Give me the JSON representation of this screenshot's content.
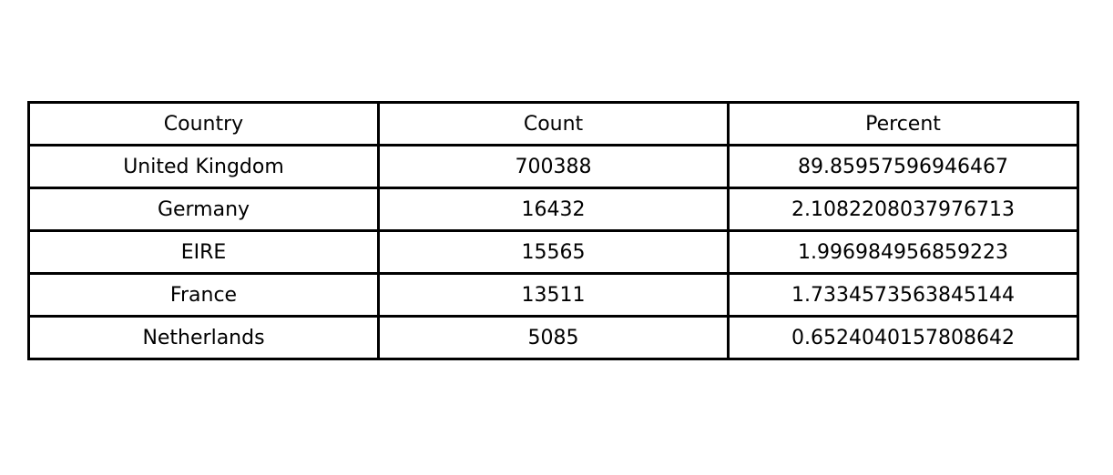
{
  "chart_data": {
    "type": "table",
    "columns": [
      "Country",
      "Count",
      "Percent"
    ],
    "rows": [
      [
        "United Kingdom",
        "700388",
        "89.85957596946467"
      ],
      [
        "Germany",
        "16432",
        "2.1082208037976713"
      ],
      [
        "EIRE",
        "15565",
        "1.996984956859223"
      ],
      [
        "France",
        "13511",
        "1.7334573563845144"
      ],
      [
        "Netherlands",
        "5085",
        "0.6524040157808642"
      ]
    ]
  }
}
